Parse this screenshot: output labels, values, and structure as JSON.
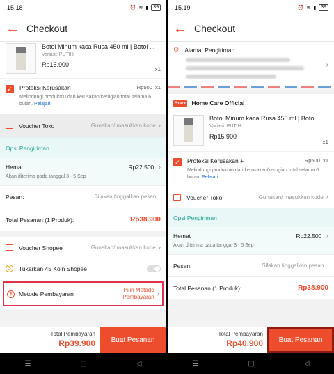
{
  "left": {
    "status": {
      "time": "15.18",
      "battery": "39"
    },
    "header": {
      "title": "Checkout",
      "back_icon": "arrow-left-icon"
    },
    "product": {
      "name": "Botol Minum kaca Rusa 450 ml | Botol ...",
      "variant": "Variasi: PUTIH",
      "price": "Rp15.900",
      "qty": "x1"
    },
    "protection": {
      "label": "Proteksi Kerusakan +",
      "price": "Rp500",
      "qty": "x1",
      "desc": "Melindungi produkmu dari kerusakan/kerugian total selama 6 bulan.",
      "link": "Pelajari"
    },
    "voucher_toko": {
      "label": "Voucher Toko",
      "hint": "Gunakan/ masukkan kode"
    },
    "shipping": {
      "title": "Opsi Pengiriman",
      "method": "Hemat",
      "price": "Rp22.500",
      "eta": "Akan diterima pada tanggal 3 - 5 Sep"
    },
    "message": {
      "label": "Pesan:",
      "placeholder": "Silakan tinggalkan pesan..."
    },
    "order_total": {
      "label": "Total Pesanan (1 Produk):",
      "value": "Rp38.900"
    },
    "voucher_shopee": {
      "label": "Voucher Shopee",
      "hint": "Gunakan/ masukkan kode"
    },
    "coins": {
      "label": "Tukarkan 45 Koin Shopee"
    },
    "payment": {
      "label": "Metode Pembayaran",
      "choose_line1": "Pilih Metode",
      "choose_line2": "Pembayaran"
    },
    "bottom": {
      "total_label": "Total Pembayaran",
      "total_value": "Rp39.900",
      "button": "Buat Pesanan"
    }
  },
  "right": {
    "status": {
      "time": "15.19",
      "battery": "39"
    },
    "header": {
      "title": "Checkout",
      "back_icon": "arrow-left-icon"
    },
    "address": {
      "title": "Alamat Pengiriman"
    },
    "shop": {
      "badge": "Star+",
      "name": "Home Care Official"
    },
    "product": {
      "name": "Botol Minum kaca Rusa 450 ml | Botol ...",
      "variant": "Variasi: PUTIH",
      "price": "Rp15.900",
      "qty": "x1"
    },
    "protection": {
      "label": "Proteksi Kerusakan +",
      "price": "Rp500",
      "qty": "x1",
      "desc": "Melindungi produkmu dari kerusakan/kerugian total selama 6 bulan.",
      "link": "Pelajari"
    },
    "voucher_toko": {
      "label": "Voucher Toko",
      "hint": "Gunakan/ masukkan kode"
    },
    "shipping": {
      "title": "Opsi Pengiriman",
      "method": "Hemat",
      "price": "Rp22.500",
      "eta": "Akan diterima pada tanggal 3 - 5 Sep"
    },
    "message": {
      "label": "Pesan:",
      "placeholder": "Silakan tinggalkan pesan..."
    },
    "order_total": {
      "label": "Total Pesanan (1 Produk):",
      "value": "Rp38.900"
    },
    "bottom": {
      "total_label": "Total Pembayaran",
      "total_value": "Rp40.900",
      "button": "Buat Pesanan"
    }
  },
  "colors": {
    "accent": "#ee4d2d",
    "shipping_teal": "#1fa392",
    "highlight": "#e0344d"
  }
}
